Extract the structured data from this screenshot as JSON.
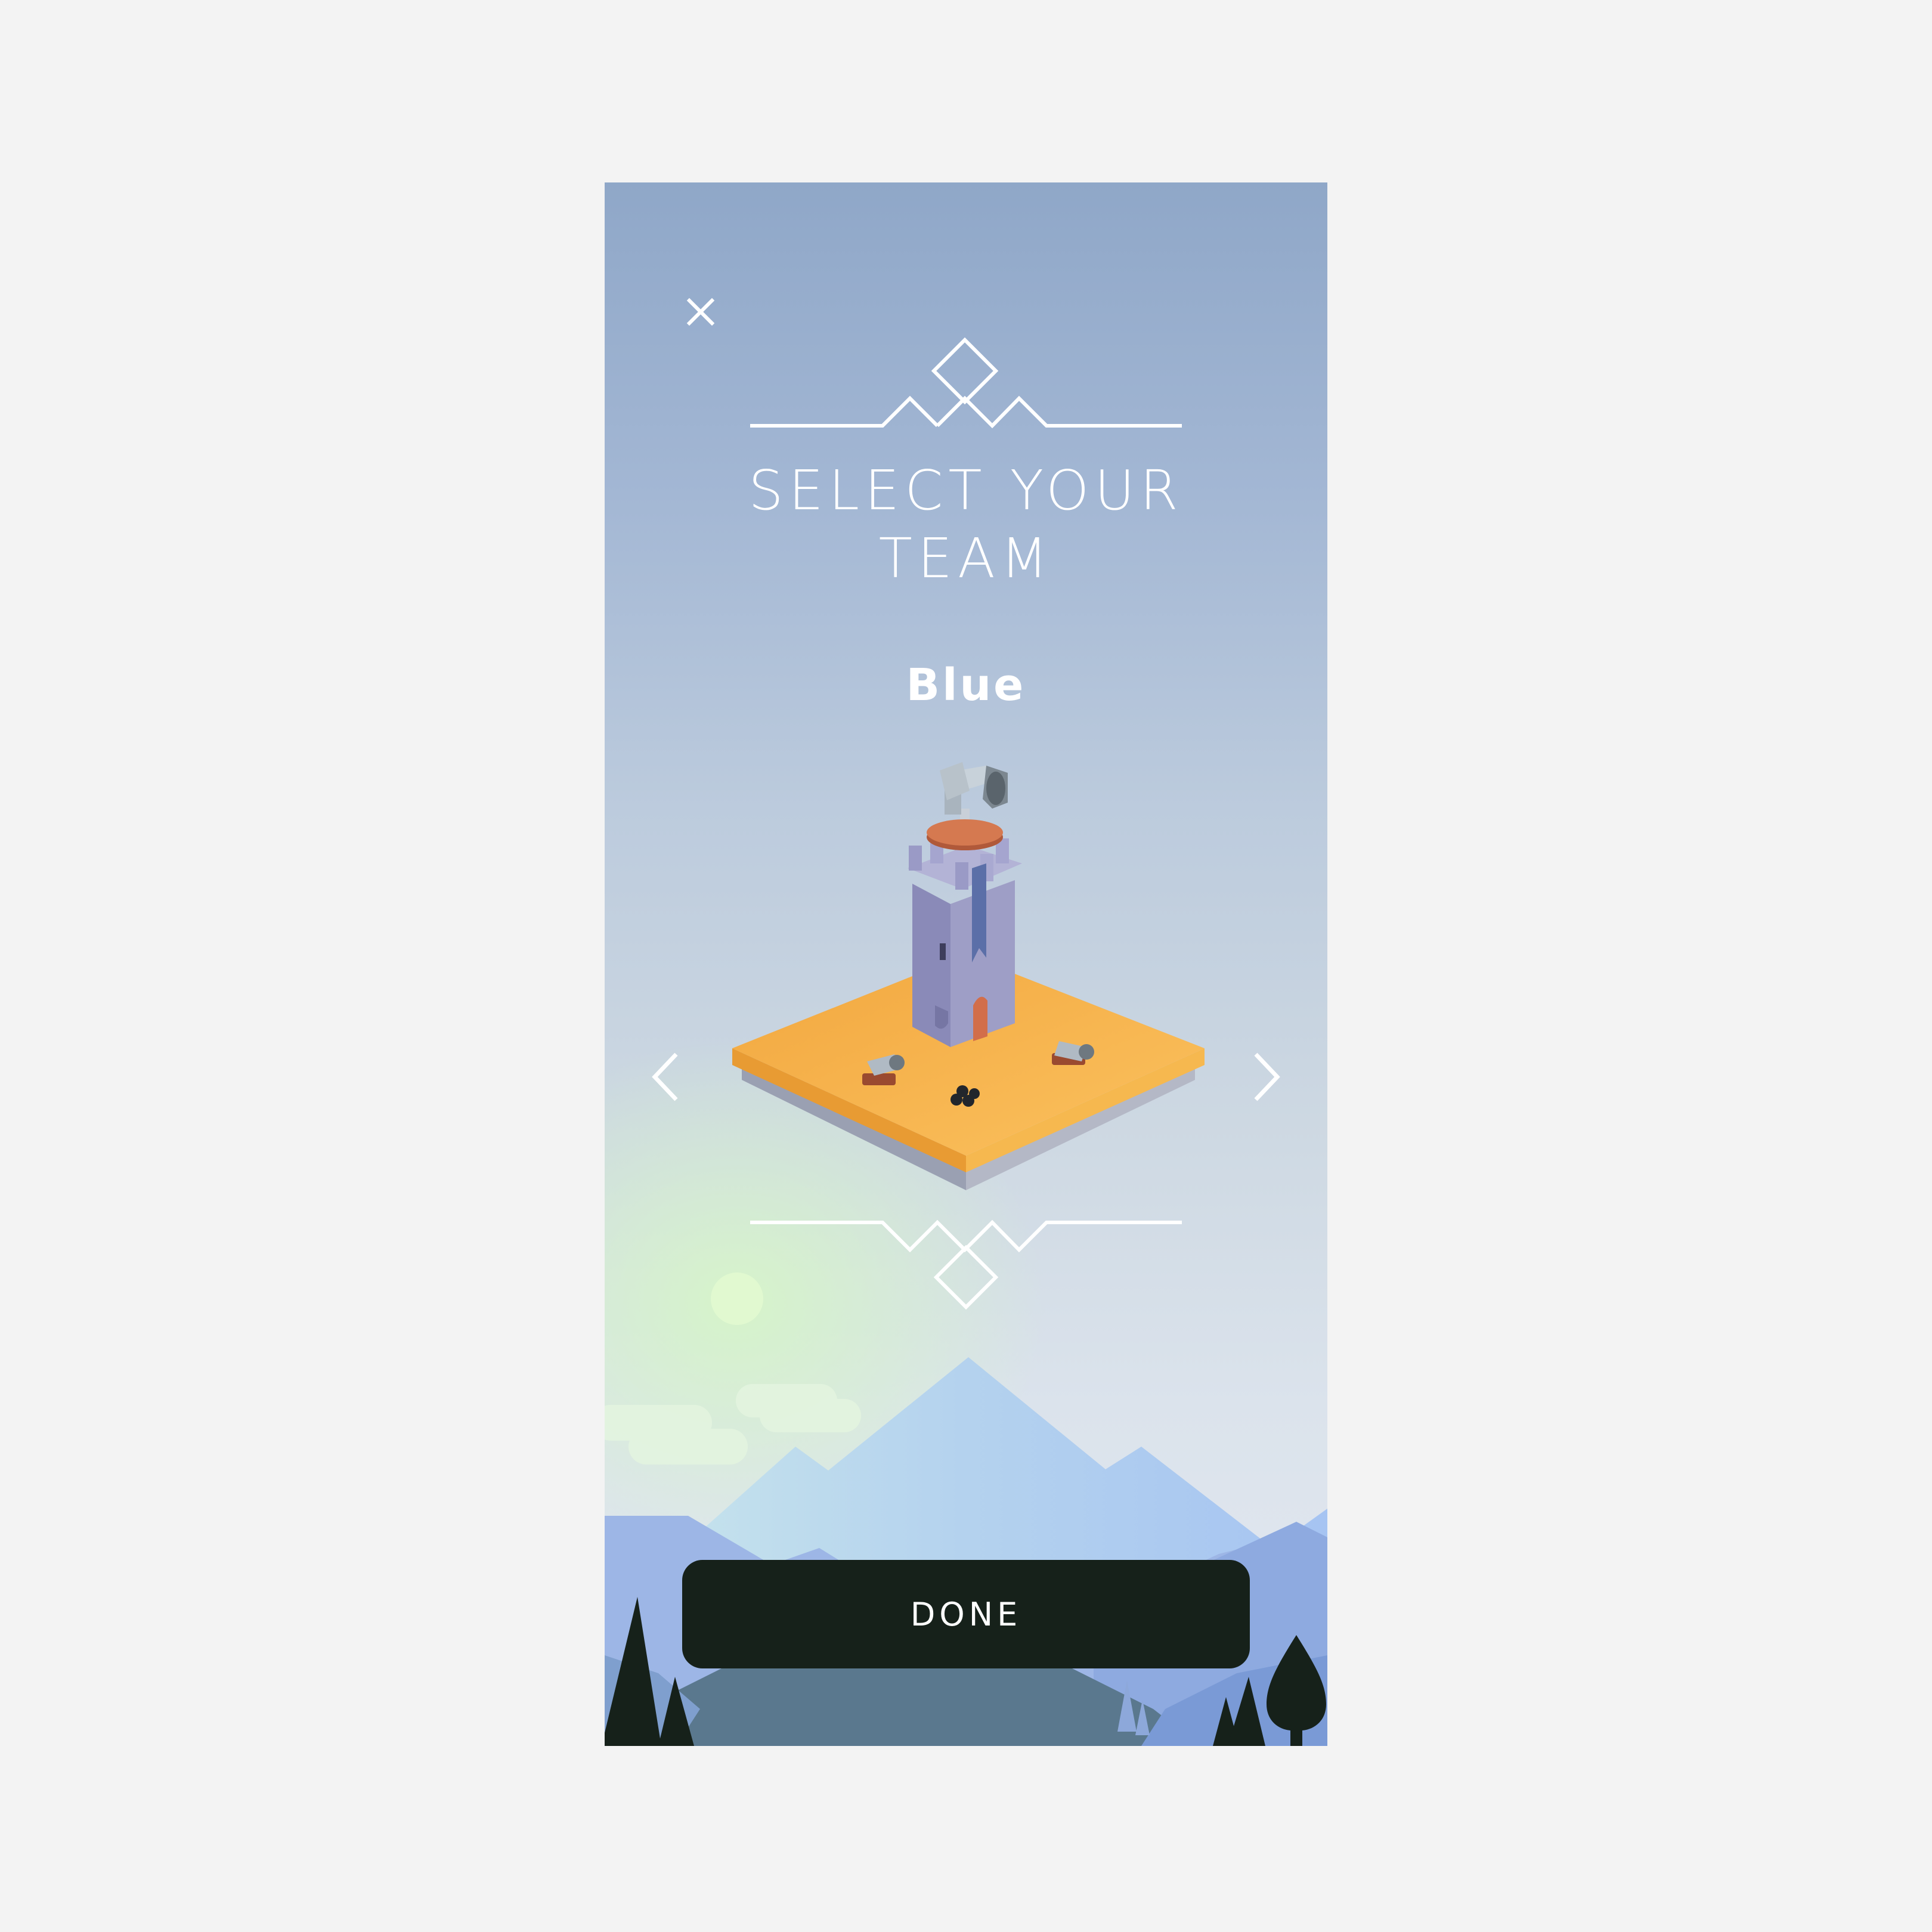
{
  "screen": {
    "title": "SELECT YOUR\nTEAM",
    "team_name": "Blue",
    "done_label": "DONE"
  },
  "icons": {
    "close": "close-icon",
    "prev": "chevron-left-icon",
    "next": "chevron-right-icon"
  },
  "colors": {
    "background": "#f3f3f3",
    "sky_top": "#8fa7c8",
    "sky_bottom": "#e3e8f0",
    "button": "#16211a",
    "platform": "#f5b04f",
    "tower": "#8f8fb8",
    "mountain": "#a9c4f0"
  }
}
